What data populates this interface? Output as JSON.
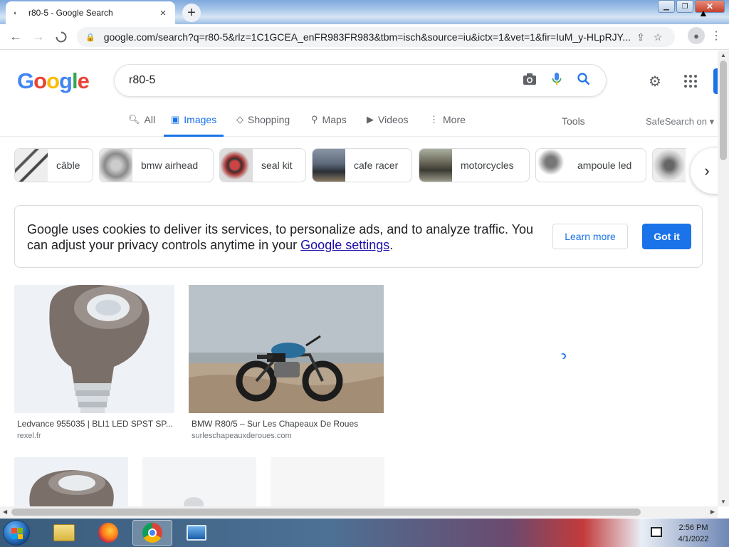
{
  "browser": {
    "tab_title": "r80-5 - Google Search",
    "url": "google.com/search?q=r80-5&rlz=1C1GCEA_enFR983FR983&tbm=isch&source=iu&ictx=1&vet=1&fir=IuM_y-HLpRJY..."
  },
  "google": {
    "logo": [
      "G",
      "o",
      "o",
      "g",
      "l",
      "e"
    ],
    "logo_colors": [
      "#4285F4",
      "#EA4335",
      "#FBBC05",
      "#4285F4",
      "#34A853",
      "#EA4335"
    ],
    "query": "r80-5",
    "tabs": [
      {
        "label": "All",
        "icon": "search-icon"
      },
      {
        "label": "Images",
        "icon": "image-icon"
      },
      {
        "label": "Shopping",
        "icon": "tag-icon"
      },
      {
        "label": "Maps",
        "icon": "map-pin-icon"
      },
      {
        "label": "Videos",
        "icon": "play-icon"
      },
      {
        "label": "More",
        "icon": "vertical-dots-icon"
      }
    ],
    "active_tab": "Images",
    "tools": "Tools",
    "safesearch": "SafeSearch on"
  },
  "chips": [
    {
      "label": "câble",
      "thumb": "#6d6d6d"
    },
    {
      "label": "bmw airhead",
      "thumb": "#9a9a9a"
    },
    {
      "label": "seal kit",
      "thumb": "#8c3a2e"
    },
    {
      "label": "cafe racer",
      "thumb": "#3e4a5a"
    },
    {
      "label": "motorcycles",
      "thumb": "#5a5a4a"
    },
    {
      "label": "ampoule led",
      "thumb": "#d8d8d8"
    },
    {
      "label": "",
      "thumb": "#b0b0b0"
    }
  ],
  "cookie": {
    "text_before": "Google uses cookies to deliver its services, to personalize ads, and to analyze traffic. You can adjust your privacy controls anytime in your ",
    "link": "Google settings",
    "text_after": ".",
    "learn_more": "Learn more",
    "got_it": "Got it"
  },
  "results": [
    {
      "caption": "Ledvance 955035 | BLI1 LED SPST SP...",
      "source": "rexel.fr"
    },
    {
      "caption": "BMW R80/5 – Sur Les Chapeaux De Roues",
      "source": "surleschapeauxderoues.com"
    }
  ],
  "taskbar": {
    "time": "2:56 PM",
    "date": "4/1/2022"
  },
  "colors": {
    "accent": "#1a73e8",
    "link": "#1a0dab"
  }
}
